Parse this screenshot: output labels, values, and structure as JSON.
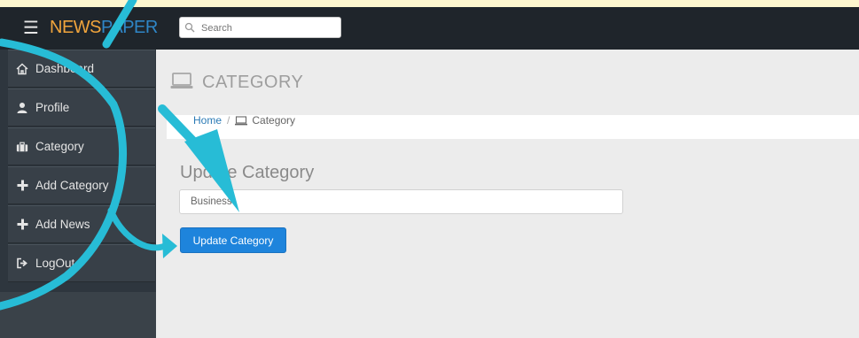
{
  "brand": {
    "part1": "NEWS",
    "part2": "PAPER"
  },
  "search": {
    "placeholder": "Search"
  },
  "sidebar": {
    "items": [
      {
        "label": "Dashboard",
        "icon": "home-icon"
      },
      {
        "label": "Profile",
        "icon": "user-icon"
      },
      {
        "label": "Category",
        "icon": "briefcase-icon"
      },
      {
        "label": "Add Category",
        "icon": "plus-icon"
      },
      {
        "label": "Add News",
        "icon": "plus-icon"
      },
      {
        "label": "LogOut",
        "icon": "logout-icon"
      }
    ]
  },
  "header": {
    "title": "CATEGORY",
    "icon": "laptop-icon"
  },
  "breadcrumb": {
    "home": "Home",
    "separator": "/",
    "current": "Category"
  },
  "form": {
    "title": "Update Category",
    "input_value": "Business",
    "button_label": "Update Category"
  },
  "colors": {
    "topbar": "#1f252b",
    "sidebar": "#384048",
    "brand_orange": "#f0a43c",
    "brand_blue": "#2f86c7",
    "button_blue": "#1e84dc",
    "annotation_arrow": "#27bcd6",
    "outer_background": "#fdf7cf"
  }
}
